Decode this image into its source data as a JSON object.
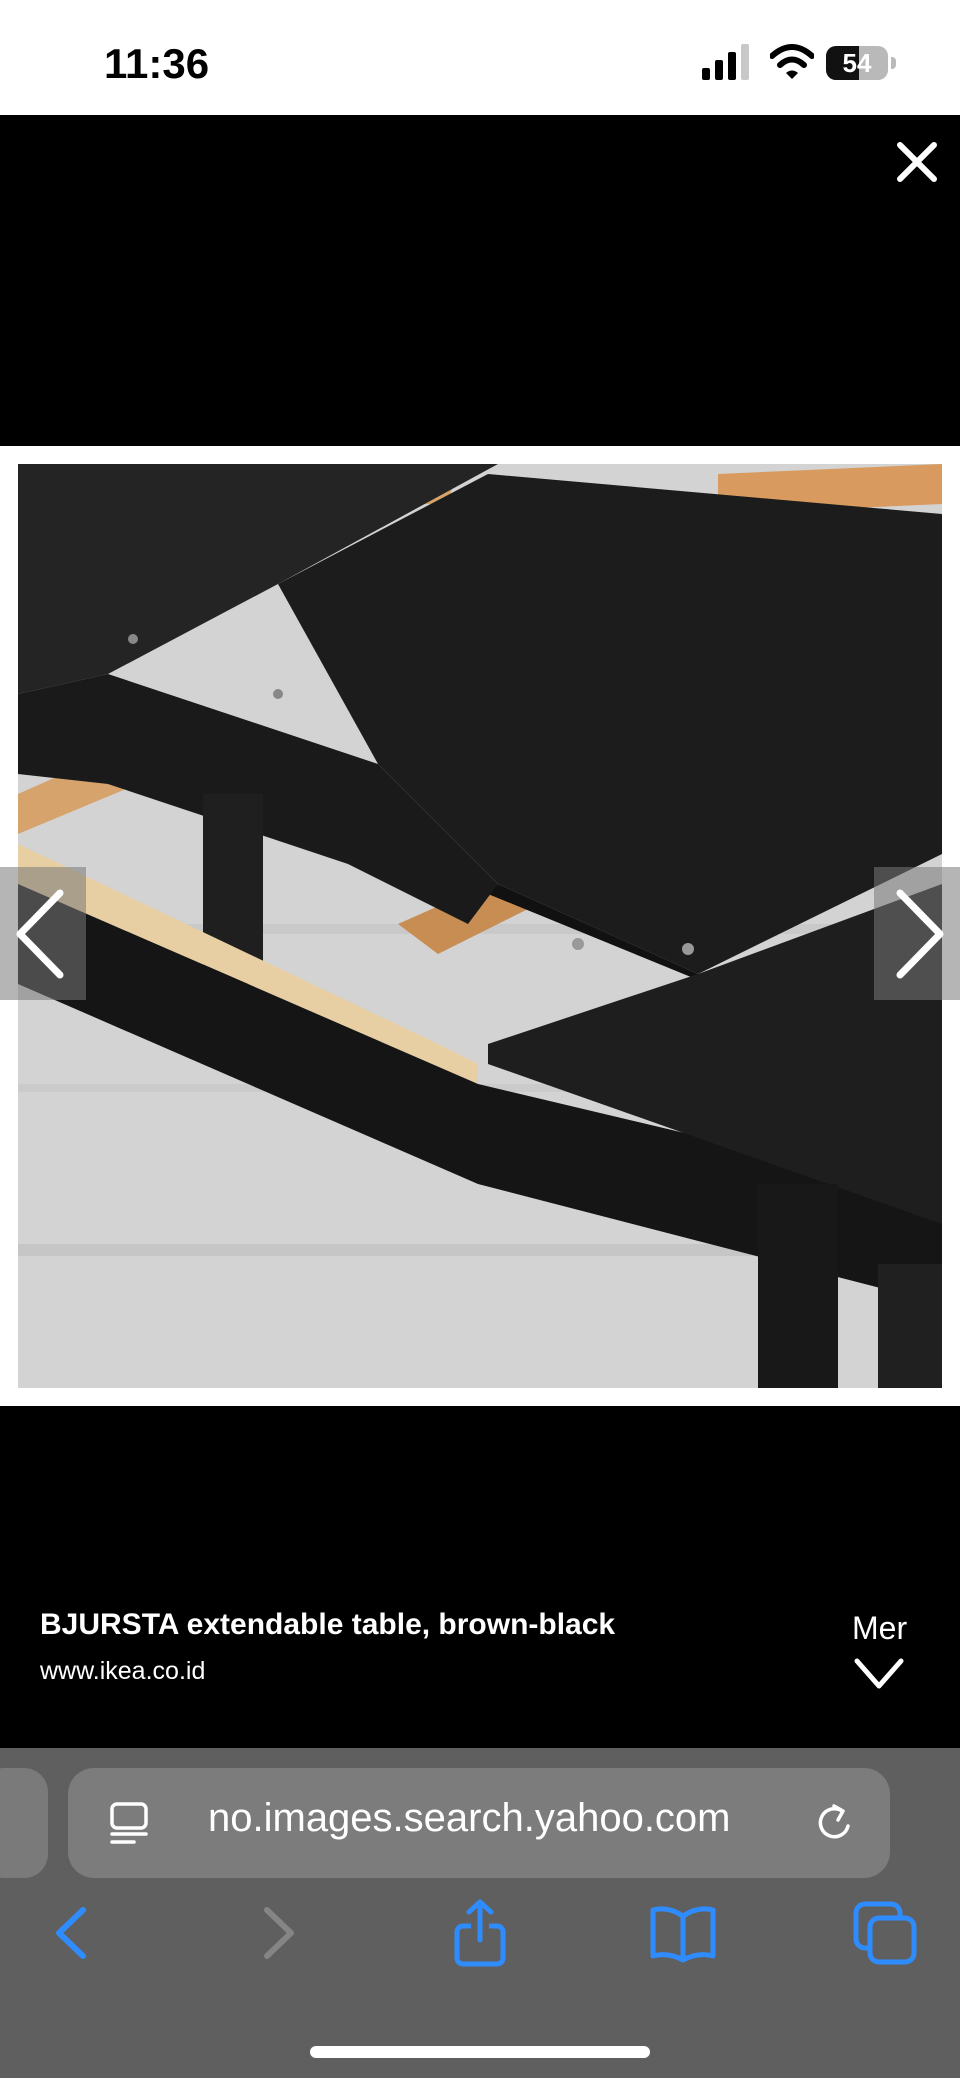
{
  "status_bar": {
    "time": "11:36",
    "battery_percent": "54",
    "battery_level": 0.54
  },
  "image_viewer": {
    "close_icon": "close-icon",
    "prev_icon": "chevron-left-icon",
    "next_icon": "chevron-right-icon",
    "caption": {
      "title": "BJURSTA extendable table, brown-black",
      "source": "www.ikea.co.id"
    },
    "more_label": "Mer"
  },
  "browser": {
    "address": "no.images.search.yahoo.com",
    "accent_color": "#2f8cff",
    "toolbar_icons": [
      "back-icon",
      "forward-icon",
      "share-icon",
      "bookmarks-icon",
      "tabs-icon"
    ]
  }
}
